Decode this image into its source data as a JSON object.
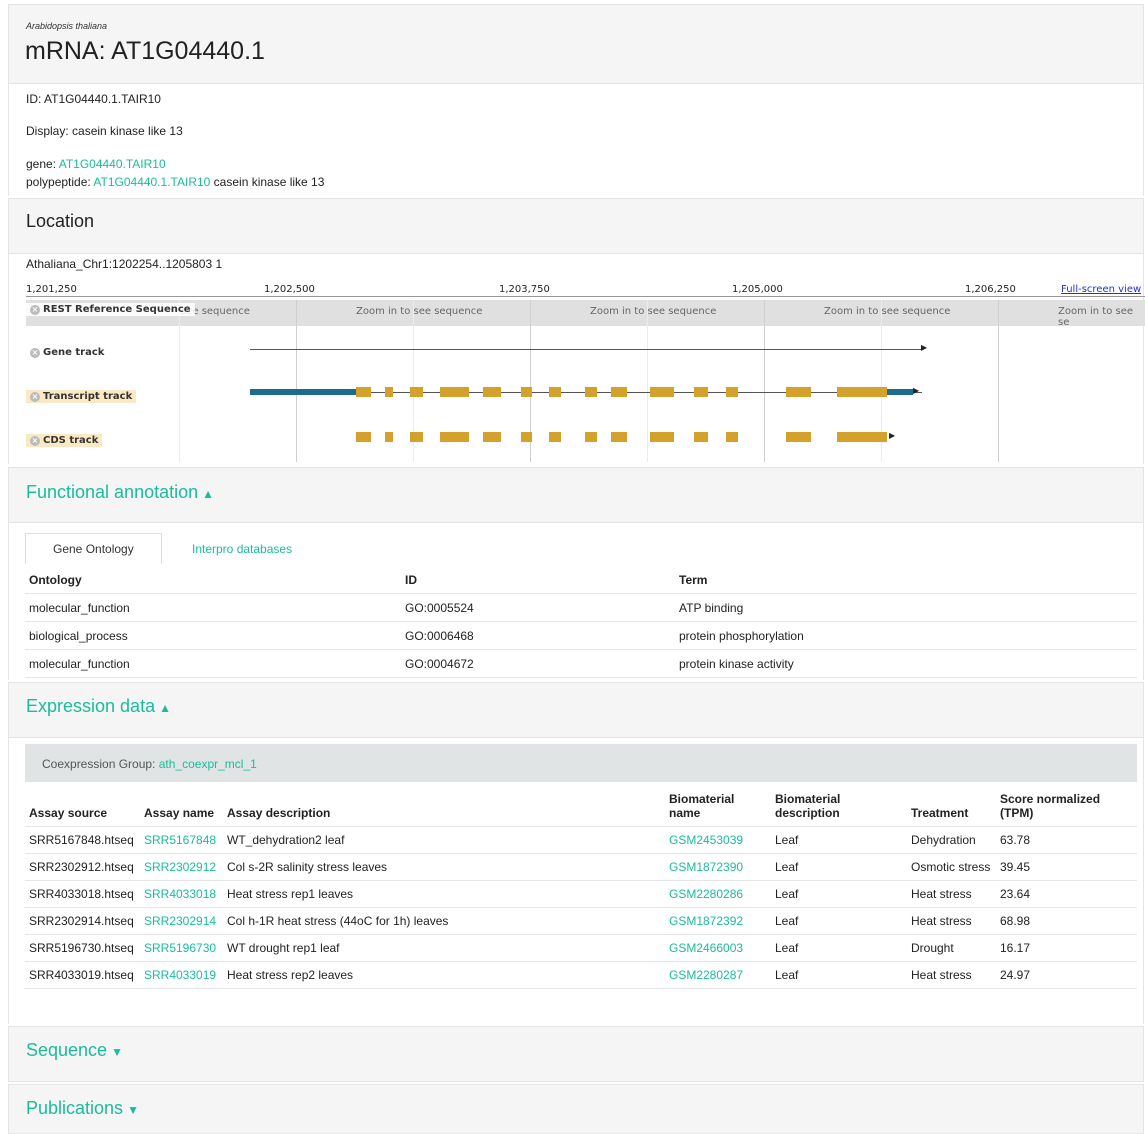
{
  "header": {
    "organism": "Arabidopsis thaliana",
    "title": "mRNA: AT1G04440.1",
    "id_text": "ID: AT1G04440.1.TAIR10",
    "display_text": "Display: casein kinase like 13",
    "gene_label": "gene: ",
    "gene_link": "AT1G04440.TAIR10",
    "polypeptide_label": "polypeptide: ",
    "polypeptide_link": "AT1G04440.1.TAIR10",
    "polypeptide_desc": " casein kinase like 13"
  },
  "location": {
    "title": "Location",
    "coords": "Athaliana_Chr1:1202254..1205803 1",
    "ruler": [
      "1,201,250",
      "1,202,500",
      "1,203,750",
      "1,205,000",
      "1,206,250"
    ],
    "fullscreen": "Full-screen view",
    "zoom_text": "Zoom in to see sequence",
    "zoom_text_partial": "see sequence",
    "zoom_text_cut": "Zoom in to see se",
    "tracks": {
      "reference": "REST Reference Sequence",
      "gene": "Gene track",
      "transcript": "Transcript track",
      "cds": "CDS track"
    },
    "colors": {
      "exon": "#d4a22b",
      "utr": "#1a6e8a"
    }
  },
  "functional": {
    "title": "Functional annotation",
    "tabs": [
      "Gene Ontology",
      "Interpro databases"
    ],
    "columns": [
      "Ontology",
      "ID",
      "Term"
    ],
    "rows": [
      [
        "molecular_function",
        "GO:0005524",
        "ATP binding"
      ],
      [
        "biological_process",
        "GO:0006468",
        "protein phosphorylation"
      ],
      [
        "molecular_function",
        "GO:0004672",
        "protein kinase activity"
      ]
    ]
  },
  "expression": {
    "title": "Expression data",
    "coexpr_label": "Coexpression Group: ",
    "coexpr_link": "ath_coexpr_mcl_1",
    "columns": [
      "Assay source",
      "Assay name",
      "Assay description",
      "Biomaterial name",
      "Biomaterial description",
      "Treatment",
      "Score normalized (TPM)"
    ],
    "rows": [
      [
        "SRR5167848.htseq",
        "SRR5167848",
        "WT_dehydration2 leaf",
        "GSM2453039",
        "Leaf",
        "Dehydration",
        "63.78"
      ],
      [
        "SRR2302912.htseq",
        "SRR2302912",
        "Col s-2R salinity stress leaves",
        "GSM1872390",
        "Leaf",
        "Osmotic stress",
        "39.45"
      ],
      [
        "SRR4033018.htseq",
        "SRR4033018",
        "Heat stress rep1 leaves",
        "GSM2280286",
        "Leaf",
        "Heat stress",
        "23.64"
      ],
      [
        "SRR2302914.htseq",
        "SRR2302914",
        "Col h-1R heat stress (44oC for 1h) leaves",
        "GSM1872392",
        "Leaf",
        "Heat stress",
        "68.98"
      ],
      [
        "SRR5196730.htseq",
        "SRR5196730",
        "WT drought rep1 leaf",
        "GSM2466003",
        "Leaf",
        "Drought",
        "16.17"
      ],
      [
        "SRR4033019.htseq",
        "SRR4033019",
        "Heat stress rep2 leaves",
        "GSM2280287",
        "Leaf",
        "Heat stress",
        "24.97"
      ]
    ]
  },
  "sequence": {
    "title": "Sequence"
  },
  "publications": {
    "title": "Publications"
  }
}
